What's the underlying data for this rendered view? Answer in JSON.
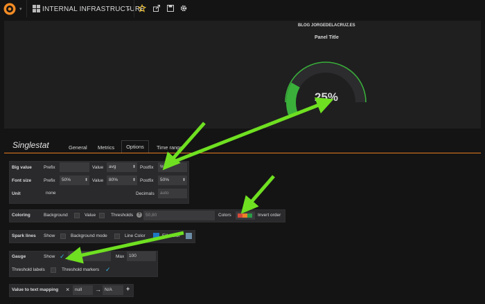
{
  "nav": {
    "title": "INTERNAL INFRASTRUCTURE",
    "caret": "▾"
  },
  "panel": {
    "blog": "BLOG JORGEDELACRUZ.ES",
    "title": "Panel Title",
    "value_text": "25%",
    "gauge_value": 25,
    "gauge_max": 100
  },
  "editor": {
    "title": "Singlestat",
    "tabs": [
      "General",
      "Metrics",
      "Options",
      "Time range"
    ]
  },
  "bigvalue": {
    "label": "Big value",
    "prefix_label": "Prefix",
    "prefix_value": "",
    "value_label": "Value",
    "value_value": "avg",
    "postfix_label": "Postfix",
    "postfix_value": "%"
  },
  "fontsize": {
    "label": "Font size",
    "prefix_label": "Prefix",
    "prefix_value": "50%",
    "value_label": "Value",
    "value_value": "80%",
    "postfix_label": "Postfix",
    "postfix_value": "50%"
  },
  "unit": {
    "label": "Unit",
    "value": "none",
    "decimals_label": "Decimals",
    "decimals_placeholder": "auto"
  },
  "coloring": {
    "label": "Coloring",
    "background_label": "Background",
    "value_label": "Value",
    "thresholds_label": "Thresholds",
    "thresholds_value": "50,80",
    "colors_label": "Colors",
    "invert_label": "Invert order",
    "swatches": [
      "#d44a3a",
      "#ed8128",
      "#299c46"
    ]
  },
  "spark": {
    "label": "Spark lines",
    "show_label": "Show",
    "bgmode_label": "Background mode",
    "linecolor_label": "Line Color",
    "fillcolor_label": "Fill Color",
    "line_color": "#1f78c1",
    "fill_color": "#6d8fa8"
  },
  "gauge": {
    "label": "Gauge",
    "show_label": "Show",
    "min_value": "0",
    "max_label": "Max",
    "max_value": "100",
    "threshold_labels": "Threshold labels",
    "threshold_markers": "Threshold markers"
  },
  "mapping": {
    "label": "Value to text mapping",
    "from_value": "null",
    "to_value": "N/A",
    "add": "+",
    "remove": "×",
    "arrow": "→"
  },
  "colors": {
    "gauge_green": "#3ab03a",
    "gauge_track": "#2c2c2e",
    "accent": "#ea7d20",
    "arrow_green": "#6fe021",
    "check_blue": "#33b5e5"
  }
}
